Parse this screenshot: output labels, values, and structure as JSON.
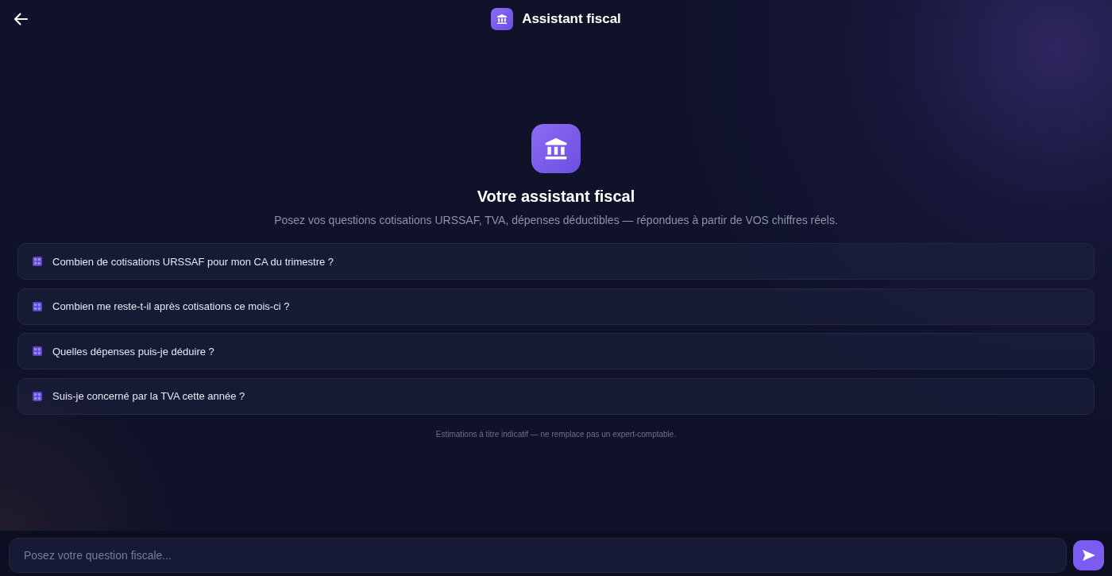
{
  "header": {
    "title": "Assistant fiscal"
  },
  "hero": {
    "title": "Votre assistant fiscal",
    "subtitle": "Posez vos questions cotisations URSSAF, TVA, dépenses déductibles — répondues à partir de VOS chiffres réels."
  },
  "suggestions": [
    "Combien de cotisations URSSAF pour mon CA du trimestre ?",
    "Combien me reste-t-il après cotisations ce mois-ci ?",
    "Quelles dépenses puis-je déduire ?",
    "Suis-je concerné par la TVA cette année ?"
  ],
  "disclaimer": "Estimations à titre indicatif — ne remplace pas un expert-comptable.",
  "composer": {
    "placeholder": "Posez votre question fiscale..."
  }
}
